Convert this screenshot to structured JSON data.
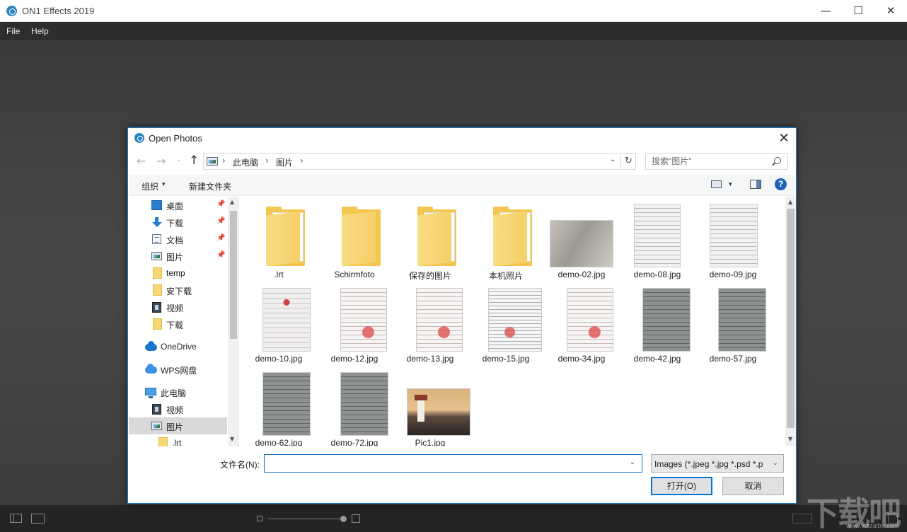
{
  "app": {
    "title": "ON1 Effects 2019",
    "window_controls": {
      "minimize": "—",
      "maximize": "☐",
      "close": "✕"
    },
    "menu": {
      "file": "File",
      "help": "Help"
    }
  },
  "dialog": {
    "title": "Open Photos",
    "close": "✕",
    "nav": {
      "back": "←",
      "forward": "→",
      "recent": "⌄",
      "up": "↑"
    },
    "address": {
      "sep": "›",
      "crumbs": [
        "此电脑",
        "图片"
      ],
      "dropdown": "⌄",
      "refresh": "↻"
    },
    "search": {
      "placeholder": "搜索\"图片\""
    },
    "toolbar": {
      "organize": "组织",
      "caret": "▾",
      "new_folder": "新建文件夹",
      "help": "?"
    },
    "nav_pane": {
      "items": [
        {
          "label": "桌面",
          "icon": "desktop-icon",
          "pinned": true
        },
        {
          "label": "下载",
          "icon": "download-icon",
          "pinned": true
        },
        {
          "label": "文档",
          "icon": "document-icon",
          "pinned": true
        },
        {
          "label": "图片",
          "icon": "pictures-icon",
          "pinned": true
        },
        {
          "label": "temp",
          "icon": "folder-icon",
          "pinned": false
        },
        {
          "label": "安下载",
          "icon": "folder-icon",
          "pinned": false
        },
        {
          "label": "视频",
          "icon": "video-icon",
          "pinned": false
        },
        {
          "label": "下载",
          "icon": "folder-icon",
          "pinned": false
        },
        {
          "label": "OneDrive",
          "icon": "onedrive-icon",
          "pinned": false
        },
        {
          "label": "WPS网盘",
          "icon": "wps-cloud-icon",
          "pinned": false
        },
        {
          "label": "此电脑",
          "icon": "this-pc-icon",
          "pinned": false
        },
        {
          "label": "视频",
          "icon": "video-icon",
          "pinned": false
        },
        {
          "label": "图片",
          "icon": "pictures-icon",
          "pinned": false,
          "selected": true
        },
        {
          "label": ".lrt",
          "icon": "folder-icon",
          "pinned": false
        }
      ],
      "pin_glyph": "📌",
      "scroll_up": "▲",
      "scroll_down": "▼"
    },
    "files": [
      {
        "name": ".lrt",
        "kind": "folder"
      },
      {
        "name": "Schirmfoto",
        "kind": "folder"
      },
      {
        "name": "保存的图片",
        "kind": "folder"
      },
      {
        "name": "本机照片",
        "kind": "folder"
      },
      {
        "name": "demo-02.jpg",
        "kind": "image"
      },
      {
        "name": "demo-08.jpg",
        "kind": "image"
      },
      {
        "name": "demo-09.jpg",
        "kind": "image"
      },
      {
        "name": "demo-10.jpg",
        "kind": "image"
      },
      {
        "name": "demo-12.jpg",
        "kind": "image"
      },
      {
        "name": "demo-13.jpg",
        "kind": "image"
      },
      {
        "name": "demo-15.jpg",
        "kind": "image"
      },
      {
        "name": "demo-34.jpg",
        "kind": "image"
      },
      {
        "name": "demo-42.jpg",
        "kind": "image"
      },
      {
        "name": "demo-57.jpg",
        "kind": "image"
      },
      {
        "name": "demo-62.jpg",
        "kind": "image"
      },
      {
        "name": "demo-72.jpg",
        "kind": "image"
      },
      {
        "name": "Pic1.jpg",
        "kind": "image"
      }
    ],
    "filename": {
      "label": "文件名(N):",
      "value": "",
      "caret": "⌄"
    },
    "filetype": {
      "value": "Images (*.jpeg *.jpg *.psd *.p",
      "caret": "⌄"
    },
    "buttons": {
      "open": "打开(O)",
      "cancel": "取消"
    }
  },
  "watermark": {
    "text": "下载吧",
    "url": "www.xiazaiba.com"
  }
}
